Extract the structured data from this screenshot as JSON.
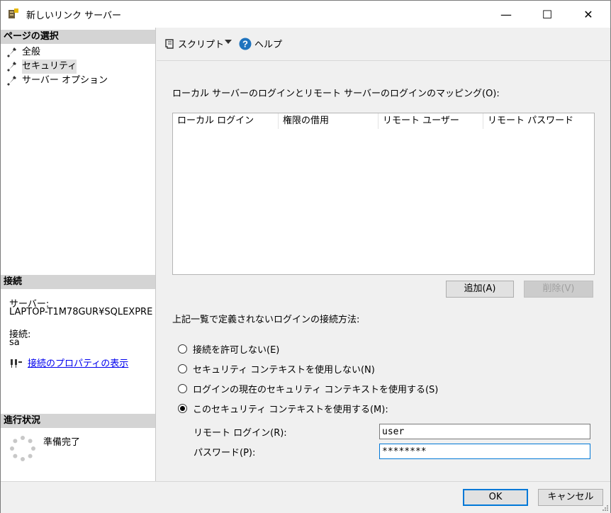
{
  "window": {
    "title": "新しいリンク サーバー",
    "minimize_glyph": "—",
    "maximize_glyph": "☐",
    "close_glyph": "✕"
  },
  "left": {
    "page_select_header": "ページの選択",
    "nav": [
      {
        "label": "全般",
        "icon": "wrench-icon"
      },
      {
        "label": "セキュリティ",
        "icon": "wrench-icon"
      },
      {
        "label": "サーバー オプション",
        "icon": "wrench-icon"
      }
    ],
    "connection_header": "接続",
    "server_label": "サーバー:",
    "server_value": "LAPTOP-T1M78GUR¥SQLEXPRE",
    "conn_label": "接続:",
    "conn_value": "sa",
    "conn_link": "接続のプロパティの表示",
    "progress_header": "進行状況",
    "progress_status": "準備完了"
  },
  "toolbar": {
    "script_label": "スクリプト",
    "help_label": "ヘルプ"
  },
  "mapping": {
    "title": "ローカル サーバーのログインとリモート サーバーのログインのマッピング(O):",
    "columns": [
      "ローカル ログイン",
      "権限の借用",
      "リモート ユーザー",
      "リモート パスワード"
    ],
    "add_button": "追加(A)",
    "remove_button": "削除(V)"
  },
  "undefined_logins": {
    "title": "上記一覧で定義されないログインの接続方法:",
    "options": [
      {
        "label": "接続を許可しない(E)",
        "checked": false
      },
      {
        "label": "セキュリティ コンテキストを使用しない(N)",
        "checked": false
      },
      {
        "label": "ログインの現在のセキュリティ コンテキストを使用する(S)",
        "checked": false
      },
      {
        "label": "このセキュリティ コンテキストを使用する(M):",
        "checked": true
      }
    ],
    "remote_login_label": "リモート ログイン(R):",
    "remote_login_value": "user",
    "password_label": "パスワード(P):",
    "password_value": "********"
  },
  "footer": {
    "ok": "OK",
    "cancel": "キャンセル"
  },
  "colors": {
    "link": "#0000ee",
    "focus_border": "#0078d7",
    "help_icon": "#1e73be"
  }
}
